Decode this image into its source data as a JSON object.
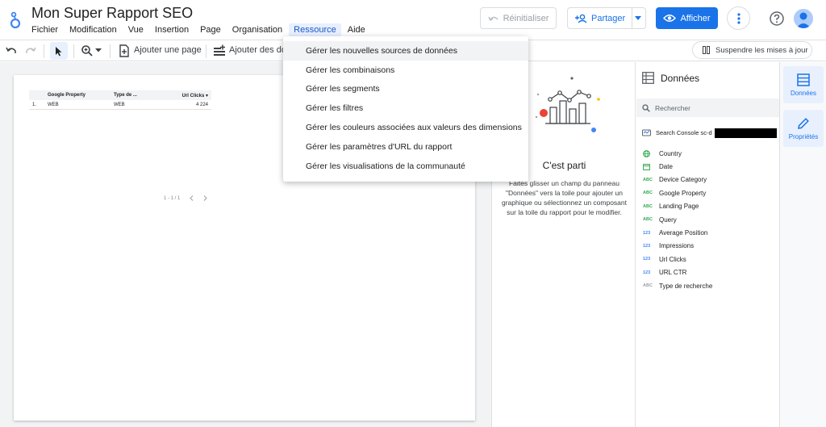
{
  "app": {
    "title": "Mon Super Rapport SEO",
    "accent_color": "#1a73e8"
  },
  "menubar": {
    "items": [
      "Fichier",
      "Modification",
      "Vue",
      "Insertion",
      "Page",
      "Organisation",
      "Ressource",
      "Aide"
    ],
    "active": "Ressource"
  },
  "header_buttons": {
    "reset_label": "Réinitialiser",
    "share_label": "Partager",
    "view_label": "Afficher"
  },
  "toolbar": {
    "add_page_label": "Ajouter une page",
    "add_data_label": "Ajouter des do",
    "pause_label": "Suspendre les mises à jour"
  },
  "dropdown": {
    "items": [
      "Gérer les nouvelles sources de données",
      "Gérer les combinaisons",
      "Gérer les segments",
      "Gérer les filtres",
      "Gérer les couleurs associées aux valeurs des dimensions",
      "Gérer les paramètres d'URL du rapport",
      "Gérer les visualisations de la communauté"
    ],
    "hovered_index": 0
  },
  "report_table": {
    "headers": [
      "Google Property",
      "Type de ...",
      "Url Clicks ▾"
    ],
    "rows": [
      {
        "index": "1.",
        "property": "WEB",
        "type": "WEB",
        "clicks": "4 224"
      }
    ],
    "pagination": "1 - 1 / 1"
  },
  "empty_state": {
    "title": "C'est parti",
    "description": "Faites glisser un champ du panneau \"Données\" vers la toile pour ajouter un graphique ou sélectionnez un composant sur la toile du rapport pour le modifier."
  },
  "data_panel": {
    "title": "Données",
    "search_placeholder": "Rechercher",
    "source_name": "Search Console sc-d",
    "fields": [
      {
        "type": "geo",
        "name": "Country"
      },
      {
        "type": "date",
        "name": "Date"
      },
      {
        "type": "ABC",
        "name": "Device Category"
      },
      {
        "type": "ABC",
        "name": "Google Property"
      },
      {
        "type": "ABC",
        "name": "Landing Page"
      },
      {
        "type": "ABC",
        "name": "Query"
      },
      {
        "type": "123",
        "name": "Average Position"
      },
      {
        "type": "123",
        "name": "Impressions"
      },
      {
        "type": "123",
        "name": "Url Clicks"
      },
      {
        "type": "123",
        "name": "URL CTR"
      },
      {
        "type": "ABC",
        "name": "Type de recherche"
      }
    ]
  },
  "side_rail": {
    "data_label": "Données",
    "props_label": "Propriétés"
  }
}
